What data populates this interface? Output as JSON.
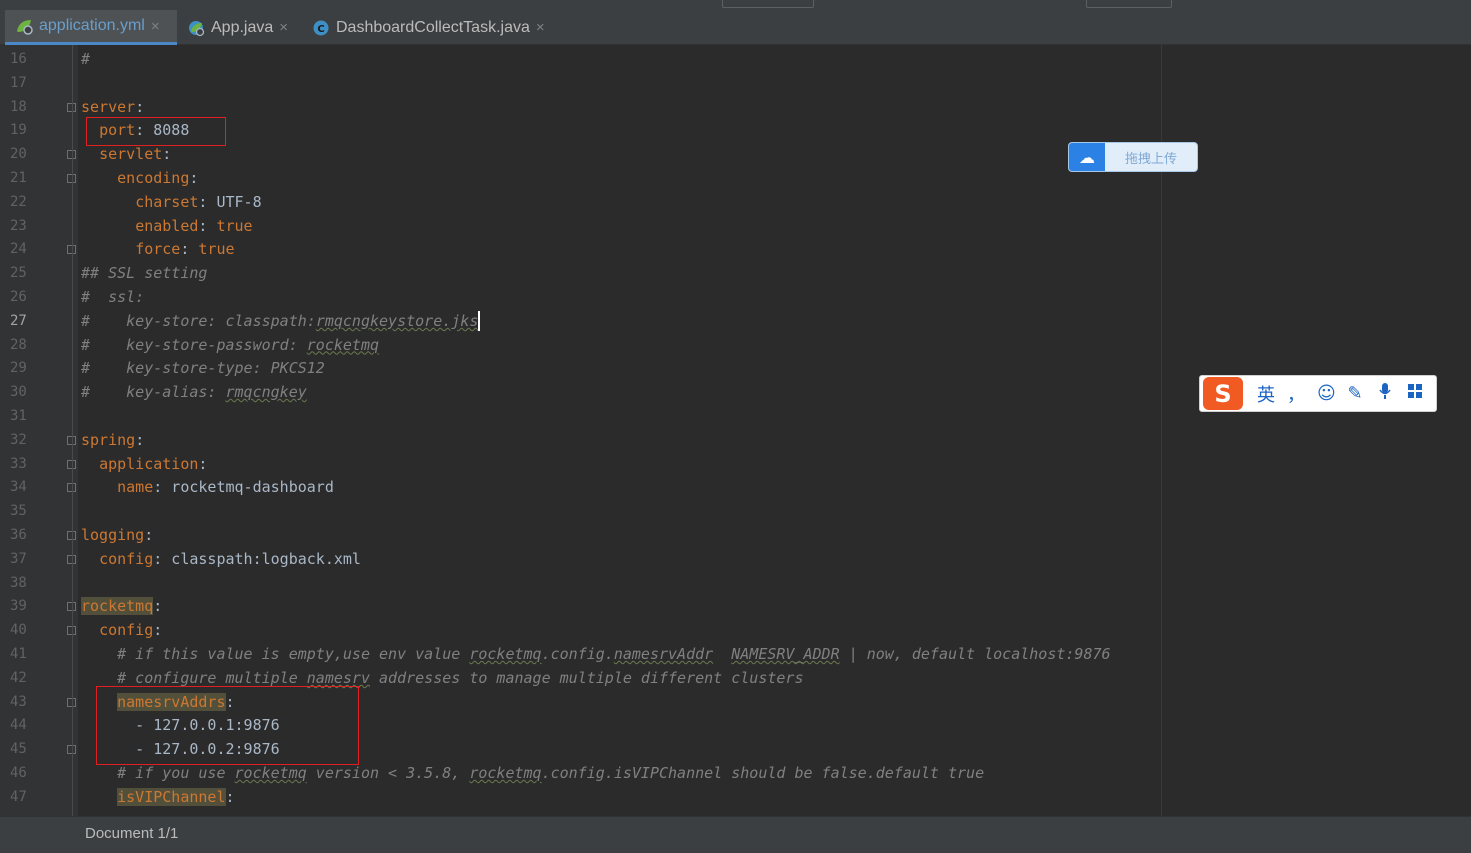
{
  "tabs": [
    {
      "label": "application.yml",
      "active": true,
      "icon": "yaml-spring-icon"
    },
    {
      "label": "App.java",
      "active": false,
      "icon": "java-app-icon"
    },
    {
      "label": "DashboardCollectTask.java",
      "active": false,
      "icon": "java-class-icon"
    }
  ],
  "close_glyph": "×",
  "editor": {
    "current_line": "27",
    "lines": [
      {
        "n": "16",
        "tokens": [
          {
            "t": "#",
            "c": "c"
          }
        ]
      },
      {
        "n": "17",
        "tokens": []
      },
      {
        "n": "18",
        "tokens": [
          {
            "t": "server",
            "c": "k"
          },
          {
            "t": ":",
            "c": "v"
          }
        ]
      },
      {
        "n": "19",
        "tokens": [
          {
            "t": "  "
          },
          {
            "t": "port",
            "c": "k"
          },
          {
            "t": ": 8088",
            "c": "v"
          }
        ]
      },
      {
        "n": "20",
        "tokens": [
          {
            "t": "  "
          },
          {
            "t": "servlet",
            "c": "k"
          },
          {
            "t": ":",
            "c": "v"
          }
        ]
      },
      {
        "n": "21",
        "tokens": [
          {
            "t": "    "
          },
          {
            "t": "encoding",
            "c": "k"
          },
          {
            "t": ":",
            "c": "v"
          }
        ]
      },
      {
        "n": "22",
        "tokens": [
          {
            "t": "      "
          },
          {
            "t": "charset",
            "c": "k"
          },
          {
            "t": ": UTF-8",
            "c": "v"
          }
        ]
      },
      {
        "n": "23",
        "tokens": [
          {
            "t": "      "
          },
          {
            "t": "enabled",
            "c": "k"
          },
          {
            "t": ": ",
            "c": "v"
          },
          {
            "t": "true",
            "c": "k"
          }
        ]
      },
      {
        "n": "24",
        "tokens": [
          {
            "t": "      "
          },
          {
            "t": "force",
            "c": "k"
          },
          {
            "t": ": ",
            "c": "v"
          },
          {
            "t": "true",
            "c": "k"
          }
        ]
      },
      {
        "n": "25",
        "tokens": [
          {
            "t": "## SSL setting",
            "c": "c"
          }
        ]
      },
      {
        "n": "26",
        "tokens": [
          {
            "t": "#  ssl:",
            "c": "c"
          }
        ]
      },
      {
        "n": "27",
        "tokens": [
          {
            "t": "#    key-store: classpath:",
            "c": "c"
          },
          {
            "t": "rmqcngkeystore",
            "c": "c w"
          },
          {
            "t": ".jks",
            "c": "c w"
          },
          {
            "t": "",
            "c": "caret"
          }
        ]
      },
      {
        "n": "28",
        "tokens": [
          {
            "t": "#    key-store-password: ",
            "c": "c"
          },
          {
            "t": "rocketmq",
            "c": "c w"
          }
        ]
      },
      {
        "n": "29",
        "tokens": [
          {
            "t": "#    key-store-type: PKCS12",
            "c": "c"
          }
        ]
      },
      {
        "n": "30",
        "tokens": [
          {
            "t": "#    key-alias: ",
            "c": "c"
          },
          {
            "t": "rmqcngkey",
            "c": "c w"
          }
        ]
      },
      {
        "n": "31",
        "tokens": []
      },
      {
        "n": "32",
        "tokens": [
          {
            "t": "spring",
            "c": "k"
          },
          {
            "t": ":",
            "c": "v"
          }
        ]
      },
      {
        "n": "33",
        "tokens": [
          {
            "t": "  "
          },
          {
            "t": "application",
            "c": "k"
          },
          {
            "t": ":",
            "c": "v"
          }
        ]
      },
      {
        "n": "34",
        "tokens": [
          {
            "t": "    "
          },
          {
            "t": "name",
            "c": "k"
          },
          {
            "t": ": rocketmq-dashboard",
            "c": "v"
          }
        ]
      },
      {
        "n": "35",
        "tokens": []
      },
      {
        "n": "36",
        "tokens": [
          {
            "t": "logging",
            "c": "k"
          },
          {
            "t": ":",
            "c": "v"
          }
        ]
      },
      {
        "n": "37",
        "tokens": [
          {
            "t": "  "
          },
          {
            "t": "config",
            "c": "k"
          },
          {
            "t": ": classpath:logback.xml",
            "c": "v"
          }
        ]
      },
      {
        "n": "38",
        "tokens": []
      },
      {
        "n": "39",
        "tokens": [
          {
            "t": "rocketmq",
            "c": "hlk"
          },
          {
            "t": ":",
            "c": "v"
          }
        ]
      },
      {
        "n": "40",
        "tokens": [
          {
            "t": "  "
          },
          {
            "t": "config",
            "c": "k"
          },
          {
            "t": ":",
            "c": "v"
          }
        ]
      },
      {
        "n": "41",
        "tokens": [
          {
            "t": "    # if this value is empty,use env value ",
            "c": "c"
          },
          {
            "t": "rocketmq",
            "c": "c w"
          },
          {
            "t": ".config.",
            "c": "c"
          },
          {
            "t": "namesrvAddr",
            "c": "c w"
          },
          {
            "t": "  ",
            "c": "c"
          },
          {
            "t": "NAMESRV_ADDR",
            "c": "c w"
          },
          {
            "t": " | now, default localhost:9876",
            "c": "c"
          }
        ]
      },
      {
        "n": "42",
        "tokens": [
          {
            "t": "    # configure multiple ",
            "c": "c"
          },
          {
            "t": "namesrv",
            "c": "c w"
          },
          {
            "t": " addresses to manage multiple different clusters",
            "c": "c"
          }
        ]
      },
      {
        "n": "43",
        "tokens": [
          {
            "t": "    "
          },
          {
            "t": "namesrvAddrs",
            "c": "hlk"
          },
          {
            "t": ":",
            "c": "v"
          }
        ]
      },
      {
        "n": "44",
        "tokens": [
          {
            "t": "      - 127.0.0.1:9876",
            "c": "v"
          }
        ]
      },
      {
        "n": "45",
        "tokens": [
          {
            "t": "      - 127.0.0.2:9876",
            "c": "v"
          }
        ]
      },
      {
        "n": "46",
        "tokens": [
          {
            "t": "    # if you use ",
            "c": "c"
          },
          {
            "t": "rocketmq",
            "c": "c w"
          },
          {
            "t": " version < 3.5.8, ",
            "c": "c"
          },
          {
            "t": "rocketmq",
            "c": "c w"
          },
          {
            "t": ".config.isVIPChannel should be false.default true",
            "c": "c"
          }
        ]
      },
      {
        "n": "47",
        "tokens": [
          {
            "t": "    "
          },
          {
            "t": "isVIPChannel",
            "c": "hlk"
          },
          {
            "t": ":",
            "c": "v"
          }
        ]
      }
    ]
  },
  "status": {
    "text": "Document 1/1"
  },
  "overlays": {
    "upload_label": "拖拽上传",
    "upload_icon": "baidu-cloud-icon",
    "ime_logo": "S",
    "ime_lang": "英",
    "ime_items": [
      {
        "glyph": "，",
        "icon": "punctuation-icon"
      },
      {
        "glyph": "☺",
        "icon": "emoji-icon"
      },
      {
        "glyph": "✎",
        "icon": "handwriting-icon"
      },
      {
        "glyph": "🎤",
        "icon": "microphone-icon"
      },
      {
        "glyph": "▦",
        "icon": "toolbox-icon"
      }
    ]
  },
  "colors": {
    "keyword": "#cc7832",
    "value": "#a9b7c6",
    "comment": "#808080",
    "accent": "#4a88c7",
    "highlight_box": "#e02020"
  }
}
